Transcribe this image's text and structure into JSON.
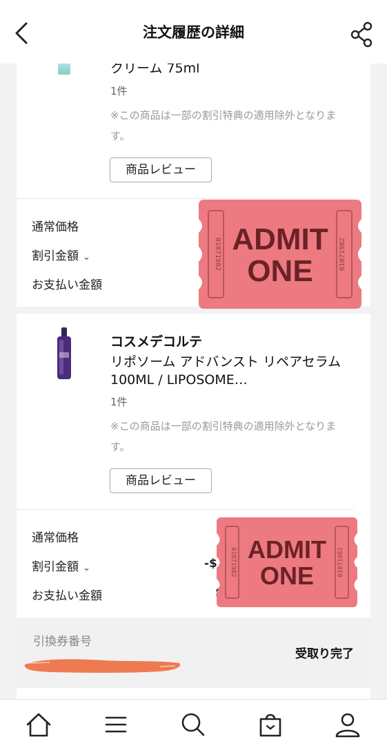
{
  "header": {
    "title": "注文履歴の詳細",
    "back_icon": "chevron-left-icon",
    "share_icon": "share-icon"
  },
  "items": [
    {
      "name": "クリーム 75ml",
      "qty": "1件",
      "note": "※この商品は一部の割引特典の適用除外となります。",
      "review_label": "商品レビュー",
      "prices": {
        "regular": "通常価格",
        "discount": "割引金額",
        "paid": "お支払い金額"
      }
    },
    {
      "brand": "コスメデコルテ",
      "name": "リポソーム アドバンスト リペアセラム 100ML / LIPOSOME…",
      "qty": "1件",
      "note": "※この商品は一部の割引特典の適用除外となります。",
      "review_label": "商品レビュー",
      "prices": {
        "regular": "通常価格",
        "discount": "割引金額",
        "paid": "お支払い金額"
      },
      "visible_fragments": {
        "discount": "-$",
        "paid": "$"
      }
    }
  ],
  "pickup": {
    "label": "引換券番号",
    "status": "受取り完了"
  },
  "sticker": {
    "top": "ADMIT",
    "bottom": "ONE",
    "serial": "01071982",
    "color": "#ec7a80"
  },
  "tabbar": [
    "home-icon",
    "menu-icon",
    "search-icon",
    "shopping-bag-icon",
    "profile-icon"
  ]
}
